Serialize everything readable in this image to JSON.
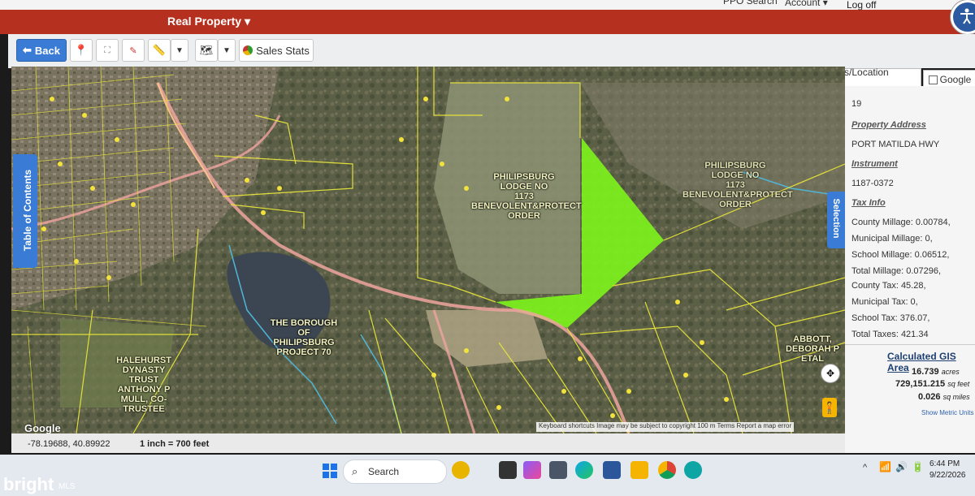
{
  "header": {
    "menu_real_property": "Real Property",
    "menu_search": "PPO Search",
    "menu_account": "Account",
    "menu_logoff": "Log off"
  },
  "toolbar": {
    "back_label": "Back",
    "sales_stats_label": "Sales Stats"
  },
  "search": {
    "address_location_label": "Address/Location Search",
    "google_label": "Google"
  },
  "side_tabs": {
    "toc_label": "Table of Contents",
    "selection_label": "Selection"
  },
  "property": {
    "partial_value": "19",
    "address_heading": "Property Address",
    "address_value": "PORT MATILDA HWY",
    "instrument_heading": "Instrument",
    "instrument_value": "1187-0372",
    "tax_heading": "Tax Info",
    "tax_lines": [
      "County Millage: 0.00784,",
      "Municipal Millage: 0,",
      "School Millage: 0.06512,",
      "Total Millage: 0.07296,",
      "County Tax: 45.28,",
      "Municipal Tax: 0,",
      "School Tax: 376.07,",
      "Total Taxes: 421.34"
    ],
    "gis_heading": "Calculated GIS Area",
    "acres_value": "16.739",
    "acres_unit": "acres",
    "sqft_value": "729,151.215",
    "sqft_unit": "sq feet",
    "sqmi_value": "0.026",
    "sqmi_unit": "sq miles",
    "metric_link": "Show Metric Units"
  },
  "map": {
    "labels": {
      "lodge_center": "PHILIPSBURG\nLODGE NO\n1173\nBENEVOLENT&PROTECT\nORDER",
      "lodge_right": "PHILIPSBURG\nLODGE NO\n1173\nBENEVOLENT&PROTECT\nORDER",
      "borough": "THE BOROUGH\nOF\nPHILIPSBURG\nPROJECT 70",
      "halehurst": "HALEHURST\nDYNASTY\nTRUST\nANTHONY P\nMULL, CO-\nTRUSTEE",
      "abbott": "ABBOTT,\nDEBORAH P\nETAL"
    },
    "attribution": "Keyboard shortcuts   Image may be subject to copyright   100 m   Terms   Report a map error",
    "google_logo": "Google",
    "highlight_color": "#7cf21c"
  },
  "status": {
    "coordinates": "-78.19688, 40.89922",
    "scale": "1 inch = 700 feet"
  },
  "taskbar": {
    "search_label": "Search",
    "time": "6:44 PM",
    "date": "9/22/2026"
  },
  "watermark": {
    "brand": "bright",
    "sub": "MLS"
  }
}
